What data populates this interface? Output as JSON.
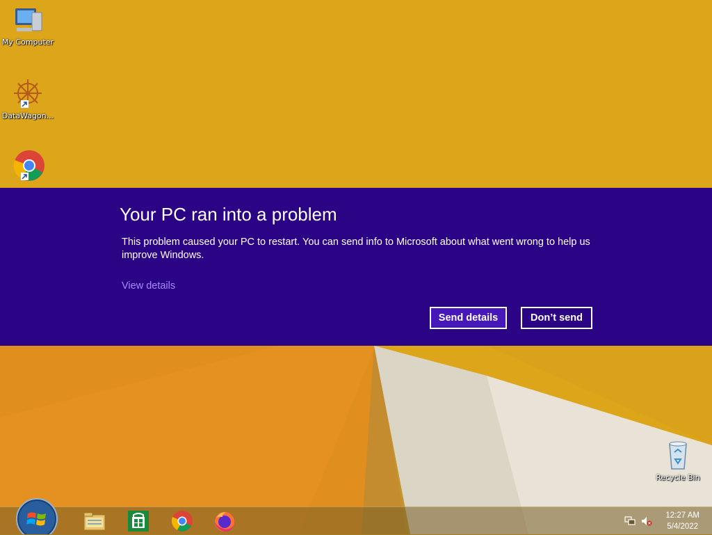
{
  "desktop": {
    "icons": [
      {
        "label": "My Computer",
        "icon": "computer-icon"
      },
      {
        "label": "DataWagon...",
        "icon": "datawagon-icon"
      },
      {
        "label": "",
        "icon": "chrome-icon"
      },
      {
        "label": "Recycle Bin",
        "icon": "recycle-bin-icon"
      }
    ]
  },
  "error_dialog": {
    "title": "Your PC ran into a problem",
    "message": "This problem caused your PC to restart. You can send info to Microsoft about what went wrong to help us improve Windows.",
    "view_details": "View details",
    "send_button": "Send details",
    "dont_send_button": "Don’t send",
    "background_color": "#2a0485",
    "link_color": "#a58cff"
  },
  "taskbar": {
    "start_icon": "windows-start-icon",
    "pinned": [
      "file-explorer-icon",
      "store-icon",
      "chrome-icon",
      "firefox-icon"
    ],
    "tray": [
      "network-icon",
      "volume-muted-icon"
    ],
    "time": "12:27 AM",
    "date": "5/4/2022"
  }
}
